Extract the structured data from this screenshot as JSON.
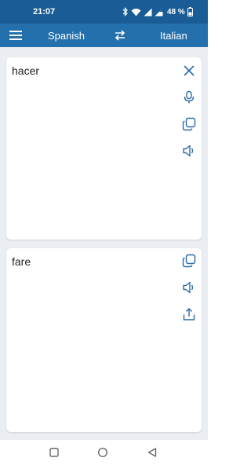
{
  "status_bar": {
    "time": "21:07",
    "battery": "48 %",
    "icons": [
      "bluetooth-icon",
      "wifi-icon",
      "signal-icon",
      "signal-icon",
      "battery-icon"
    ]
  },
  "app_bar": {
    "menu_icon": "menu-icon",
    "source_language": "Spanish",
    "swap_icon": "swap-arrows-icon",
    "target_language": "Italian",
    "background": "#2470ac"
  },
  "input_card": {
    "text": "hacer",
    "icons": [
      "close-icon",
      "microphone-icon",
      "copy-icon",
      "speaker-icon"
    ]
  },
  "output_card": {
    "text": "fare",
    "icons": [
      "copy-icon",
      "speaker-icon",
      "share-icon"
    ]
  },
  "nav_bar": {
    "icons": [
      "recents-square-icon",
      "home-circle-icon",
      "back-triangle-icon"
    ]
  },
  "colors": {
    "status_bar": "#1a5d96",
    "app_bar": "#2470ac",
    "accent_icon": "#2a6aa6",
    "panel_background": "#eaedf1"
  }
}
